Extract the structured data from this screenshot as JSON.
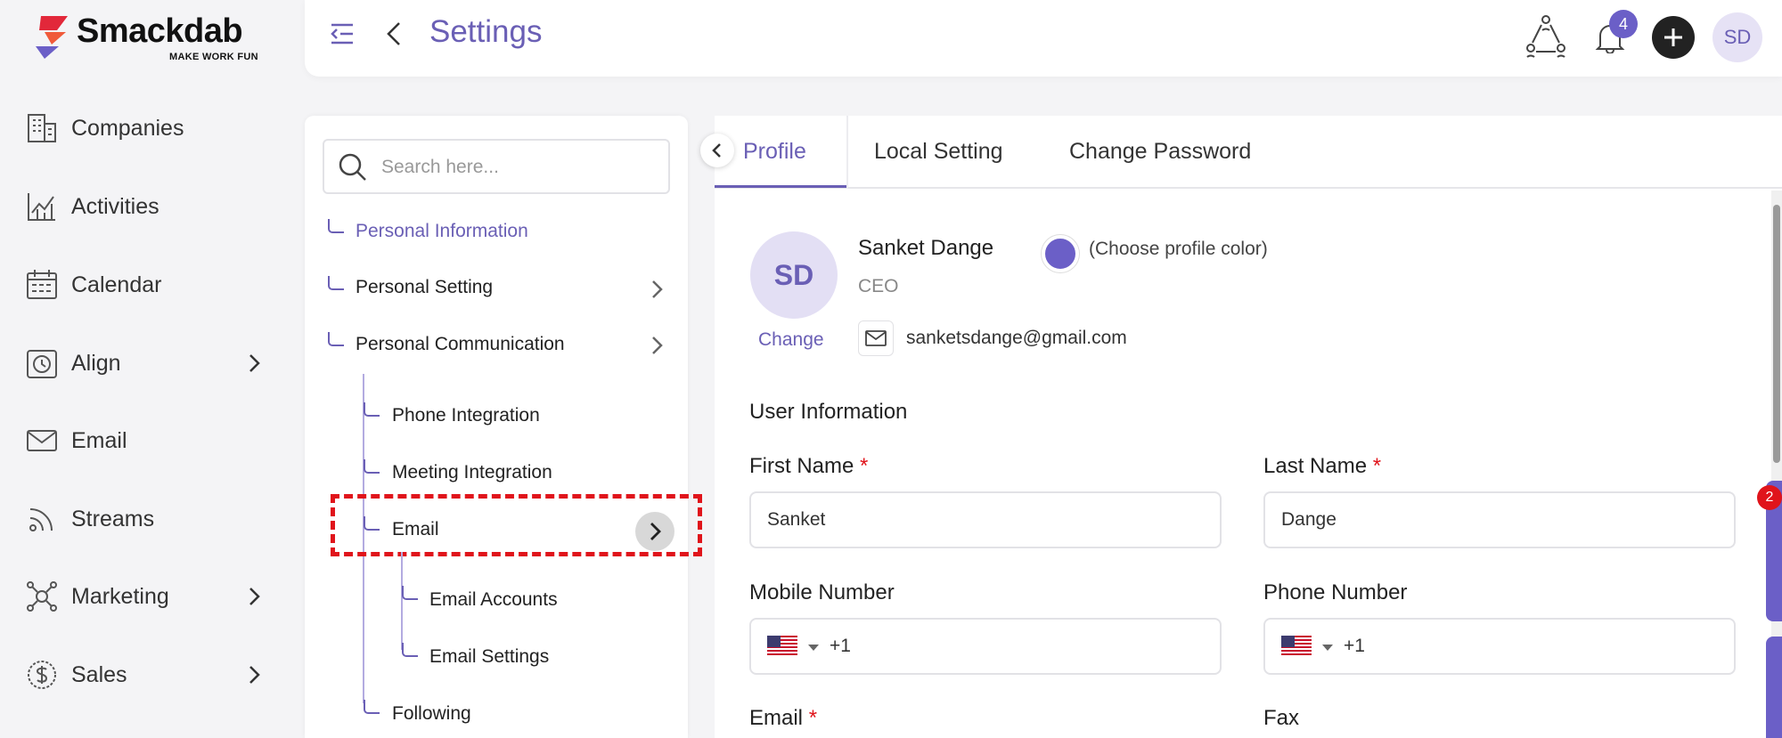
{
  "app": {
    "logo_text": "Smackdab",
    "logo_tagline": "MAKE WORK FUN"
  },
  "sidebar": {
    "items": [
      {
        "label": "Companies",
        "icon": "building-icon",
        "has_chevron": false
      },
      {
        "label": "Activities",
        "icon": "activity-chart-icon",
        "has_chevron": false
      },
      {
        "label": "Calendar",
        "icon": "calendar-icon",
        "has_chevron": false
      },
      {
        "label": "Align",
        "icon": "clock-target-icon",
        "has_chevron": true
      },
      {
        "label": "Email",
        "icon": "envelope-icon",
        "has_chevron": false
      },
      {
        "label": "Streams",
        "icon": "rss-icon",
        "has_chevron": false
      },
      {
        "label": "Marketing",
        "icon": "marketing-network-icon",
        "has_chevron": true
      },
      {
        "label": "Sales",
        "icon": "dollar-icon",
        "has_chevron": true
      }
    ]
  },
  "header": {
    "title": "Settings",
    "notification_count": "4",
    "avatar_initials": "SD"
  },
  "settings_tree": {
    "search_placeholder": "Search here...",
    "items": {
      "personal_information": "Personal Information",
      "personal_setting": "Personal Setting",
      "personal_communication": "Personal Communication",
      "phone_integration": "Phone Integration",
      "meeting_integration": "Meeting Integration",
      "email": "Email",
      "email_accounts": "Email Accounts",
      "email_settings": "Email Settings",
      "following": "Following"
    }
  },
  "tabs": [
    {
      "label": "Profile",
      "active": true
    },
    {
      "label": "Local Setting",
      "active": false
    },
    {
      "label": "Change Password",
      "active": false
    }
  ],
  "profile": {
    "initials": "SD",
    "change_label": "Change",
    "name": "Sanket Dange",
    "role": "CEO",
    "color_label": "(Choose profile color)",
    "color": "#6b5fc7",
    "email": "sanketsdange@gmail.com"
  },
  "user_information": {
    "section_title": "User Information",
    "first_name_label": "First Name",
    "first_name_value": "Sanket",
    "last_name_label": "Last Name",
    "last_name_value": "Dange",
    "mobile_label": "Mobile Number",
    "mobile_code": "+1",
    "phone_label": "Phone Number",
    "phone_code": "+1",
    "email_label": "Email",
    "fax_label": "Fax",
    "required_mark": "*"
  },
  "side_widget": {
    "badge_count": "2"
  },
  "colors": {
    "accent": "#6a5fb5",
    "highlight_box": "#e0141b"
  }
}
